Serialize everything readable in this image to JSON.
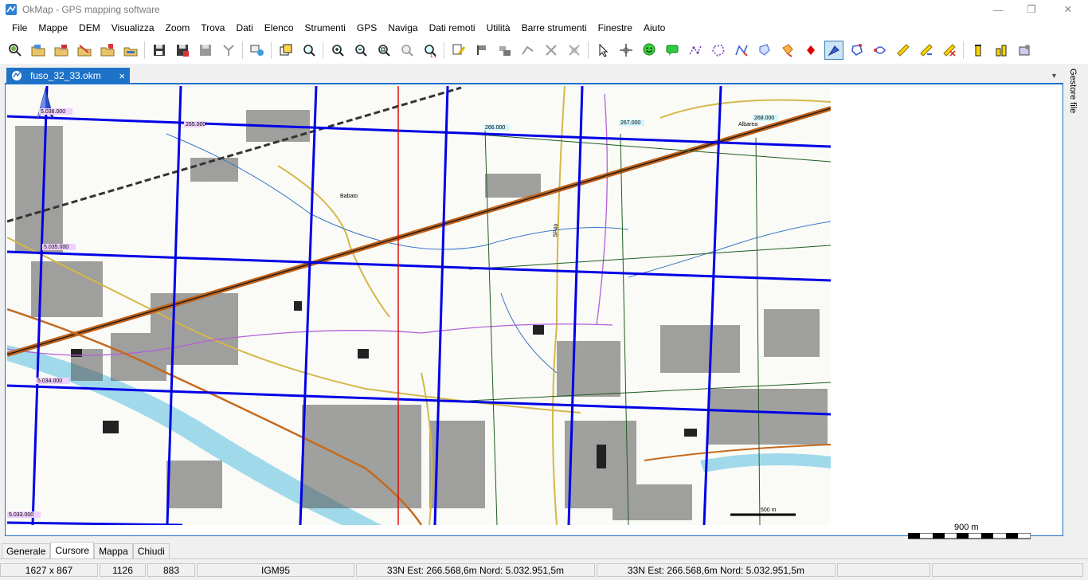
{
  "window": {
    "title": "OkMap - GPS mapping software"
  },
  "menu": [
    "File",
    "Mappe",
    "DEM",
    "Visualizza",
    "Zoom",
    "Trova",
    "Dati",
    "Elenco",
    "Strumenti",
    "GPS",
    "Naviga",
    "Dati remoti",
    "Utilità",
    "Barre strumenti",
    "Finestre",
    "Aiuto"
  ],
  "toolbar_icons": [
    "open-map-icon",
    "open-folder-icon",
    "open-calibrated-icon",
    "open-file-icon",
    "close-map-icon",
    "import-map-icon",
    "save-icon",
    "save-as-icon",
    "save-all-icon",
    "merge-icon",
    "layers-icon",
    "map-overview-icon",
    "zoom-find-icon",
    "zoom-in-icon",
    "zoom-out-icon",
    "zoom-fit-icon",
    "zoom-scale-icon",
    "zoom-1to1-icon",
    "edit-point-icon",
    "waypoint-icon",
    "waypoint-group-icon",
    "route-icon",
    "track-icon",
    "delete-track-icon",
    "cursor-icon",
    "crosshair-icon",
    "smiley-icon",
    "message-icon",
    "polyline-icon",
    "polygon-icon",
    "draw-route-icon",
    "draw-area-icon",
    "draw-fill-icon",
    "red-marker-icon",
    "select-tool-icon",
    "lasso-icon",
    "path-icon",
    "ruler-icon",
    "measure-area-icon",
    "measure-clear-icon",
    "altitude-icon",
    "compare-icon",
    "properties-icon"
  ],
  "document_tab": {
    "label": "fuso_32_33.okm",
    "close": "×"
  },
  "side_panel": {
    "label": "Gestore file"
  },
  "map": {
    "grid_labels": [
      "5.036.000",
      "265.000",
      "266.000",
      "267.000",
      "268.000",
      "5.035.000",
      "5.034.000",
      "5.033.000"
    ],
    "place_labels": [
      "Babato",
      "Albarea",
      "SP49"
    ],
    "small_scale": "500 m"
  },
  "scale_bar": {
    "label": "900 m"
  },
  "bottom_tabs": [
    {
      "label": "Generale",
      "active": false
    },
    {
      "label": "Cursore",
      "active": true
    },
    {
      "label": "Mappa",
      "active": false
    },
    {
      "label": "Chiudi",
      "active": false
    }
  ],
  "status": {
    "size": "1627 x 867",
    "px": "1126",
    "py": "883",
    "datum": "IGM95",
    "coord1": "33N  Est: 266.568,6m   Nord: 5.032.951,5m",
    "coord2": "33N  Est: 266.568,6m   Nord: 5.032.951,5m"
  },
  "colors": {
    "accent": "#1e73c8",
    "grid_blue": "#0000e6",
    "grid_green": "#1f5e1f",
    "highway": "#c0621a",
    "river": "#8fd3e8",
    "meridian": "#e00000"
  }
}
